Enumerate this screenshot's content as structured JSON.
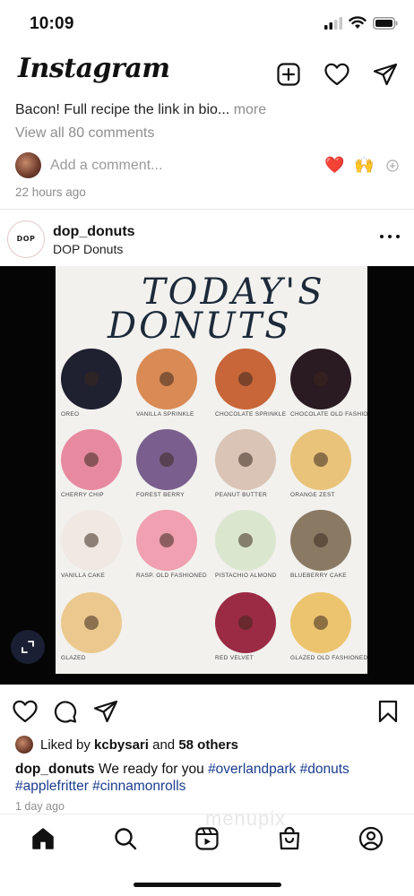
{
  "status_bar": {
    "time": "10:09"
  },
  "app": {
    "name": "Instagram"
  },
  "previous_post": {
    "caption_text": "Bacon! Full recipe the link in bio...",
    "more_label": "more",
    "view_comments": "View all 80 comments",
    "comment_placeholder": "Add a comment...",
    "quick_emojis": [
      "❤️",
      "🙌"
    ],
    "timestamp": "22 hours ago"
  },
  "post": {
    "avatar_text": "DOP",
    "username": "dop_donuts",
    "subtitle": "DOP Donuts",
    "image": {
      "poster_title_line1": "TODAY'S",
      "poster_title_line2": "DONUTS",
      "donuts": [
        {
          "label": "OREO",
          "color": "#1f2030"
        },
        {
          "label": "VANILLA SPRINKLE",
          "color": "#d98a55"
        },
        {
          "label": "CHOCOLATE SPRINKLE",
          "color": "#c8663a"
        },
        {
          "label": "CHOCOLATE OLD FASHIONED",
          "color": "#2a1a22"
        },
        {
          "label": "CHERRY CHIP",
          "color": "#e78aa0"
        },
        {
          "label": "FOREST BERRY",
          "color": "#7a5f8e"
        },
        {
          "label": "PEANUT BUTTER",
          "color": "#d9c4b6"
        },
        {
          "label": "ORANGE ZEST",
          "color": "#e9c37a"
        },
        {
          "label": "VANILLA CAKE",
          "color": "#f0e8e2"
        },
        {
          "label": "RASP. OLD FASHIONED",
          "color": "#f0a0b0"
        },
        {
          "label": "PISTACHIO ALMOND",
          "color": "#dbe6cf"
        },
        {
          "label": "BLUEBERRY CAKE",
          "color": "#8a7a64"
        },
        {
          "label": "GLAZED",
          "color": "#ebc98e"
        },
        {
          "label": "RED VELVET",
          "color": "#9b2a44"
        },
        {
          "label": "GLAZED OLD FASHIONED",
          "color": "#ecc46e"
        }
      ]
    },
    "likes": {
      "prefix": "Liked by",
      "user": "kcbysari",
      "and": "and",
      "others": "58 others"
    },
    "caption": {
      "username": "dop_donuts",
      "text": "We ready for you",
      "hashtags": [
        "#overlandpark",
        "#donuts",
        "#applefritter",
        "#cinnamonrolls"
      ]
    },
    "timestamp": "1 day ago"
  },
  "watermark": "menupix",
  "colors": {
    "heart": "#e0243b",
    "hashtag": "#1b3d8f",
    "secondary_text": "#8e8e8e"
  },
  "icons": {
    "top_bar": [
      "new-post-icon",
      "heart-icon",
      "direct-message-icon"
    ],
    "actions": [
      "like-icon",
      "comment-icon",
      "share-icon",
      "save-icon"
    ],
    "bottom_nav": [
      "home-icon",
      "search-icon",
      "reels-icon",
      "shop-icon",
      "profile-icon"
    ]
  }
}
